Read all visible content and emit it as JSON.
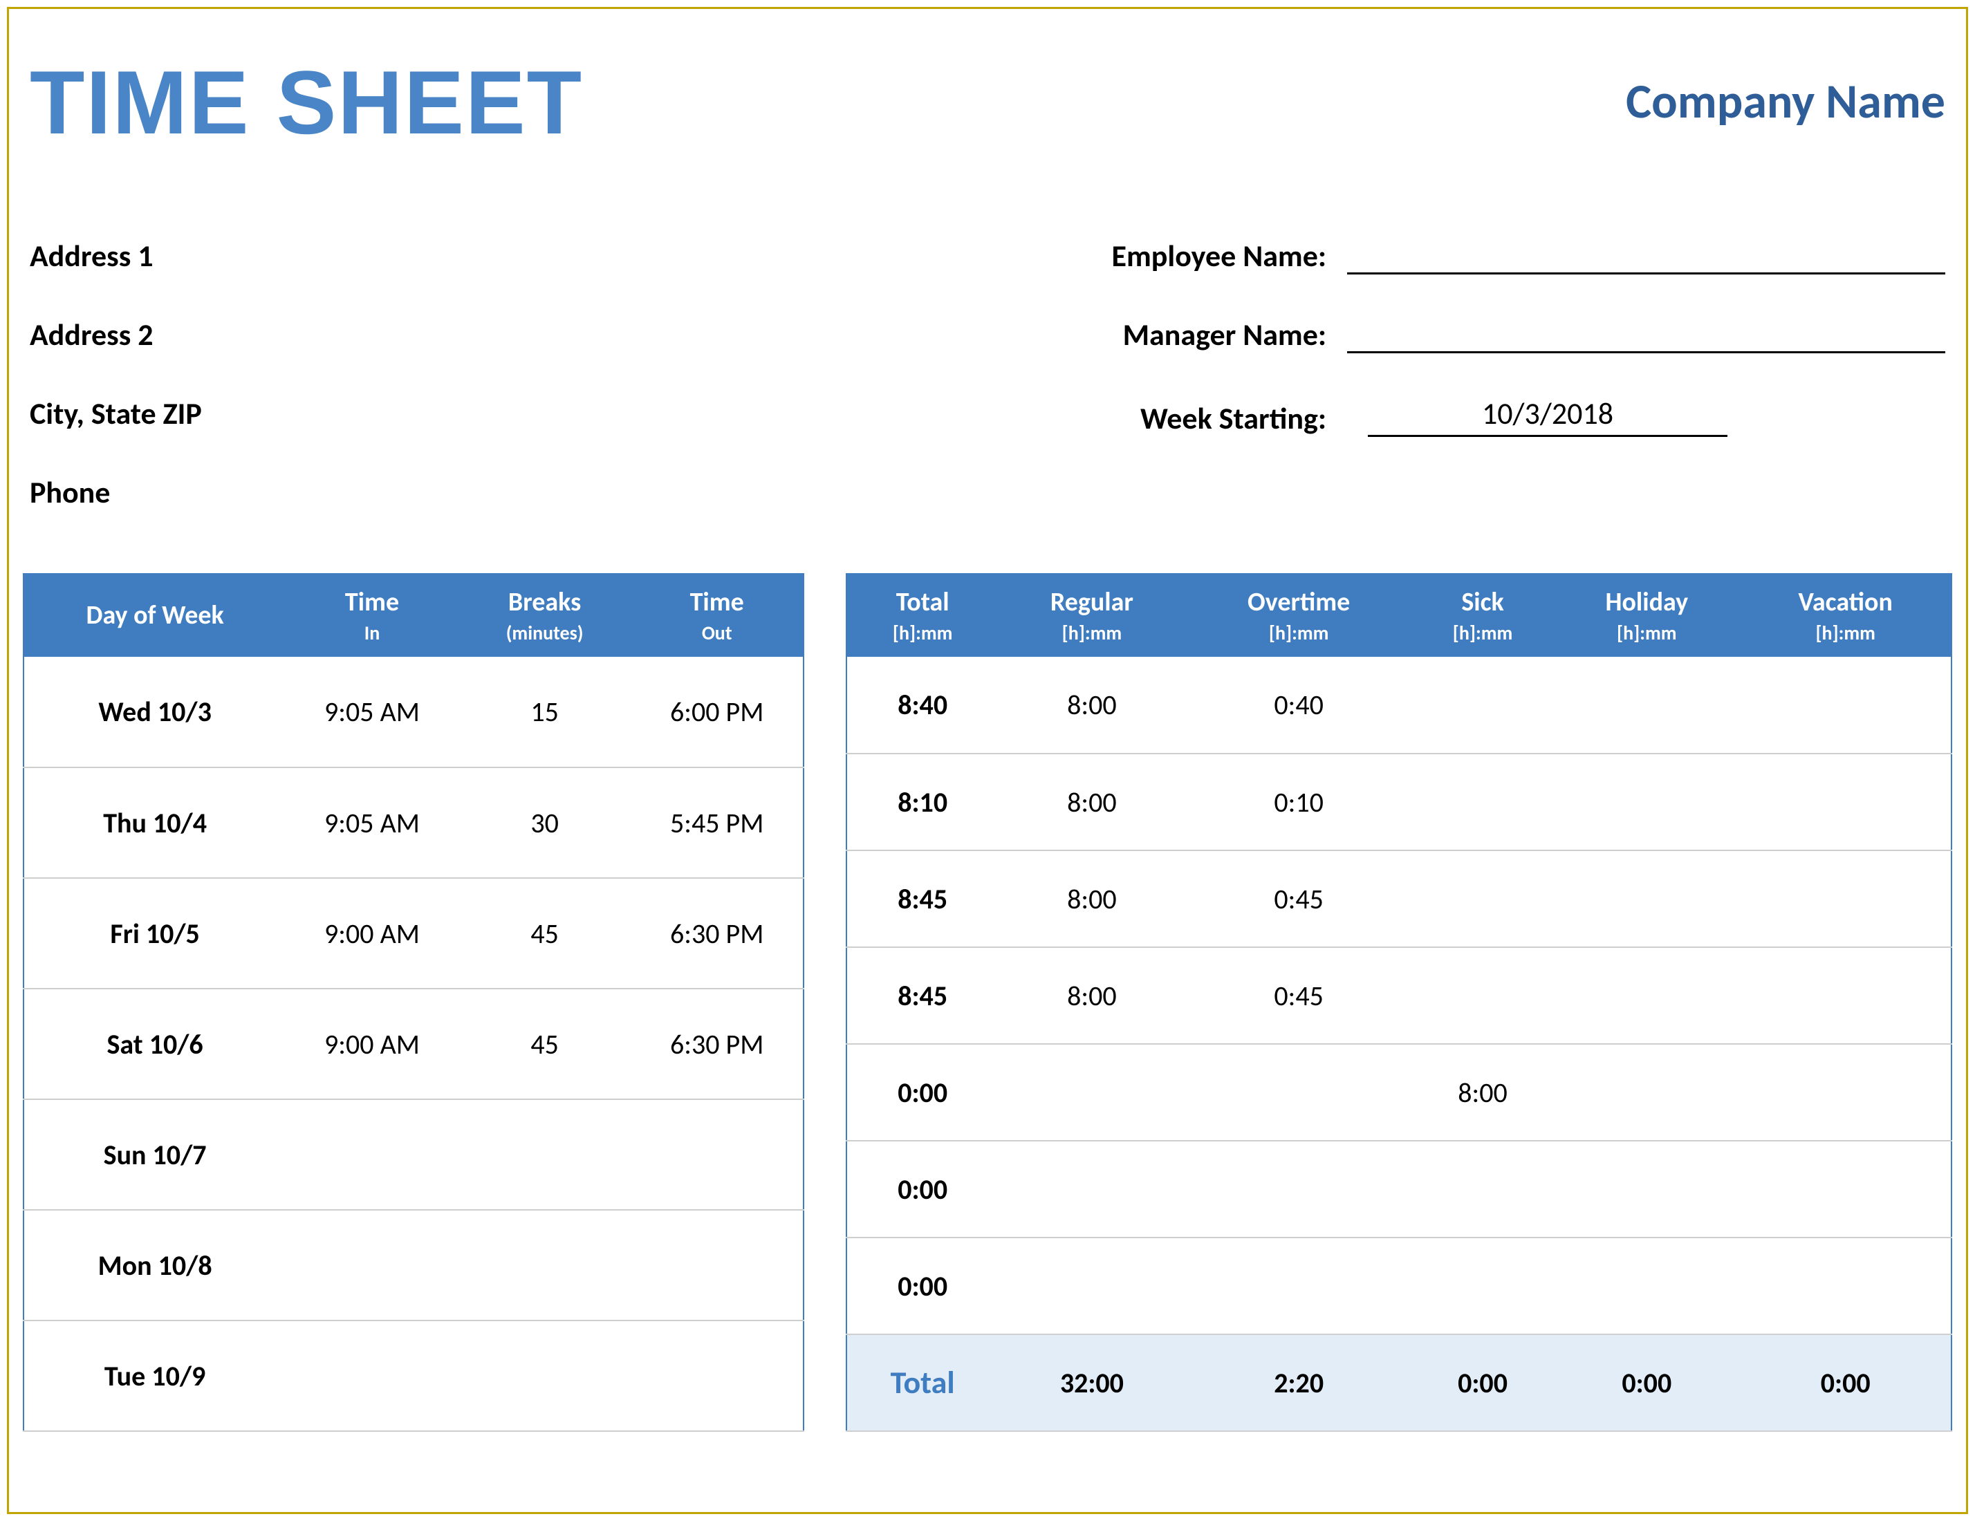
{
  "header": {
    "title": "TIME SHEET",
    "company": "Company Name"
  },
  "info": {
    "address1": "Address 1",
    "address2": "Address 2",
    "city_state_zip": "City, State  ZIP",
    "phone": "Phone",
    "employee_name_label": "Employee Name:",
    "employee_name": "",
    "manager_name_label": "Manager Name:",
    "manager_name": "",
    "week_starting_label": "Week Starting:",
    "week_starting": "10/3/2018"
  },
  "columns_left": {
    "day": "Day of Week",
    "time_in": "Time",
    "time_in_sub": "In",
    "breaks": "Breaks",
    "breaks_sub": "(minutes)",
    "time_out": "Time",
    "time_out_sub": "Out"
  },
  "columns_right": {
    "total": "Total",
    "total_sub": "[h]:mm",
    "regular": "Regular",
    "regular_sub": "[h]:mm",
    "overtime": "Overtime",
    "overtime_sub": "[h]:mm",
    "sick": "Sick",
    "sick_sub": "[h]:mm",
    "holiday": "Holiday",
    "holiday_sub": "[h]:mm",
    "vacation": "Vacation",
    "vacation_sub": "[h]:mm"
  },
  "rows": [
    {
      "day": "Wed 10/3",
      "time_in": "9:05 AM",
      "breaks": "15",
      "time_out": "6:00 PM",
      "total": "8:40",
      "regular": "8:00",
      "overtime": "0:40",
      "sick": "",
      "holiday": "",
      "vacation": ""
    },
    {
      "day": "Thu 10/4",
      "time_in": "9:05 AM",
      "breaks": "30",
      "time_out": "5:45 PM",
      "total": "8:10",
      "regular": "8:00",
      "overtime": "0:10",
      "sick": "",
      "holiday": "",
      "vacation": ""
    },
    {
      "day": "Fri 10/5",
      "time_in": "9:00 AM",
      "breaks": "45",
      "time_out": "6:30 PM",
      "total": "8:45",
      "regular": "8:00",
      "overtime": "0:45",
      "sick": "",
      "holiday": "",
      "vacation": ""
    },
    {
      "day": "Sat 10/6",
      "time_in": "9:00 AM",
      "breaks": "45",
      "time_out": "6:30 PM",
      "total": "8:45",
      "regular": "8:00",
      "overtime": "0:45",
      "sick": "",
      "holiday": "",
      "vacation": ""
    },
    {
      "day": "Sun 10/7",
      "time_in": "",
      "breaks": "",
      "time_out": "",
      "total": "0:00",
      "regular": "",
      "overtime": "",
      "sick": "8:00",
      "holiday": "",
      "vacation": ""
    },
    {
      "day": "Mon 10/8",
      "time_in": "",
      "breaks": "",
      "time_out": "",
      "total": "0:00",
      "regular": "",
      "overtime": "",
      "sick": "",
      "holiday": "",
      "vacation": ""
    },
    {
      "day": "Tue 10/9",
      "time_in": "",
      "breaks": "",
      "time_out": "",
      "total": "0:00",
      "regular": "",
      "overtime": "",
      "sick": "",
      "holiday": "",
      "vacation": ""
    }
  ],
  "totals": {
    "label": "Total",
    "regular": "32:00",
    "overtime": "2:20",
    "sick": "0:00",
    "holiday": "0:00",
    "vacation": "0:00"
  }
}
